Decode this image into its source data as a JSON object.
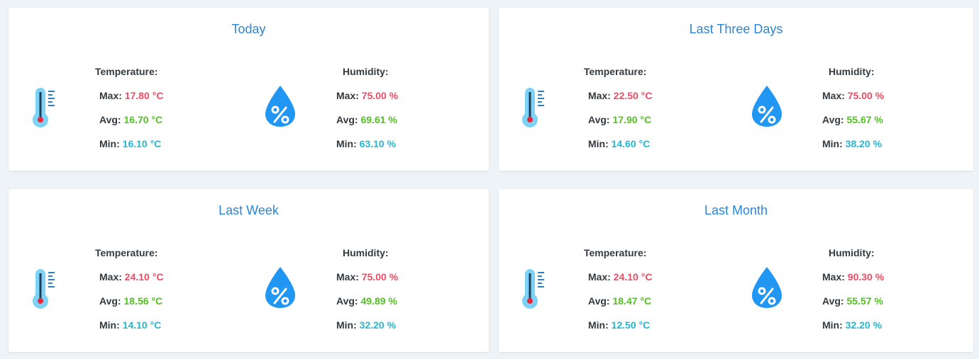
{
  "colors": {
    "title": "#2a86d8",
    "max": "#ef4b63",
    "avg": "#52c11f",
    "min": "#25b7cf",
    "thermometer": "#7dd3f5",
    "drop": "#2196f3"
  },
  "labels": {
    "temperature": "Temperature:",
    "humidity": "Humidity:",
    "max": "Max:",
    "avg": "Avg:",
    "min": "Min:"
  },
  "icons": {
    "temperature": "thermometer-icon",
    "humidity": "humidity-drop-icon"
  },
  "cards": [
    {
      "title": "Today",
      "temperature": {
        "max": "17.80 °C",
        "avg": "16.70 °C",
        "min": "16.10 °C"
      },
      "humidity": {
        "max": "75.00 %",
        "avg": "69.61 %",
        "min": "63.10 %"
      }
    },
    {
      "title": "Last Three Days",
      "temperature": {
        "max": "22.50 °C",
        "avg": "17.90 °C",
        "min": "14.60 °C"
      },
      "humidity": {
        "max": "75.00 %",
        "avg": "55.67 %",
        "min": "38.20 %"
      }
    },
    {
      "title": "Last Week",
      "temperature": {
        "max": "24.10 °C",
        "avg": "18.56 °C",
        "min": "14.10 °C"
      },
      "humidity": {
        "max": "75.00 %",
        "avg": "49.89 %",
        "min": "32.20 %"
      }
    },
    {
      "title": "Last Month",
      "temperature": {
        "max": "24.10 °C",
        "avg": "18.47 °C",
        "min": "12.50 °C"
      },
      "humidity": {
        "max": "90.30 %",
        "avg": "55.57 %",
        "min": "32.20 %"
      }
    }
  ]
}
